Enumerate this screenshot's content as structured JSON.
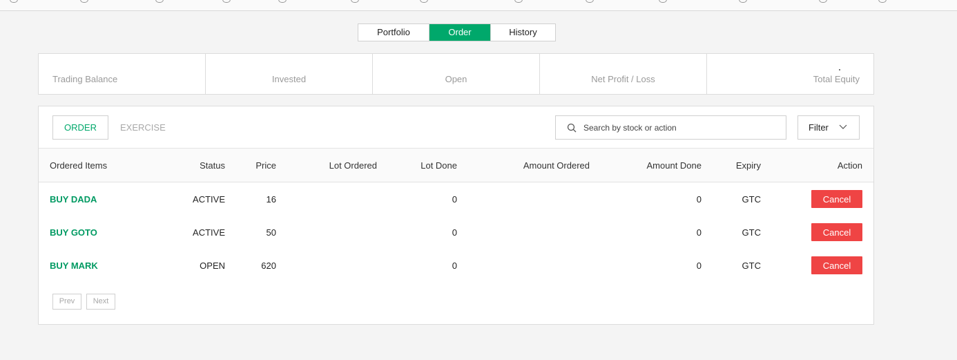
{
  "tabs": [
    {
      "label": "Portfolio",
      "active": false
    },
    {
      "label": "Order",
      "active": true
    },
    {
      "label": "History",
      "active": false
    }
  ],
  "summary": {
    "trading_balance_label": "Trading Balance",
    "invested_label": "Invested",
    "open_label": "Open",
    "net_profit_label": "Net Profit / Loss",
    "total_equity_label": "Total Equity"
  },
  "toolbar": {
    "order_label": "ORDER",
    "exercise_label": "EXERCISE",
    "search_placeholder": "Search by stock or action",
    "filter_label": "Filter"
  },
  "table": {
    "headers": {
      "item": "Ordered Items",
      "status": "Status",
      "price": "Price",
      "lot_ordered": "Lot Ordered",
      "lot_done": "Lot Done",
      "amount_ordered": "Amount Ordered",
      "amount_done": "Amount Done",
      "expiry": "Expiry",
      "action": "Action"
    },
    "rows": [
      {
        "item": "BUY DADA",
        "status": "ACTIVE",
        "price": "16",
        "lot_done": "0",
        "amount_done": "0",
        "expiry": "GTC",
        "action": "Cancel"
      },
      {
        "item": "BUY GOTO",
        "status": "ACTIVE",
        "price": "50",
        "lot_done": "0",
        "amount_done": "0",
        "expiry": "GTC",
        "action": "Cancel"
      },
      {
        "item": "BUY MARK",
        "status": "OPEN",
        "price": "620",
        "lot_done": "0",
        "amount_done": "0",
        "expiry": "GTC",
        "action": "Cancel"
      }
    ]
  },
  "pagination": {
    "prev": "Prev",
    "next": "Next"
  },
  "colors": {
    "accent": "#00a86b",
    "danger": "#ef4444"
  }
}
